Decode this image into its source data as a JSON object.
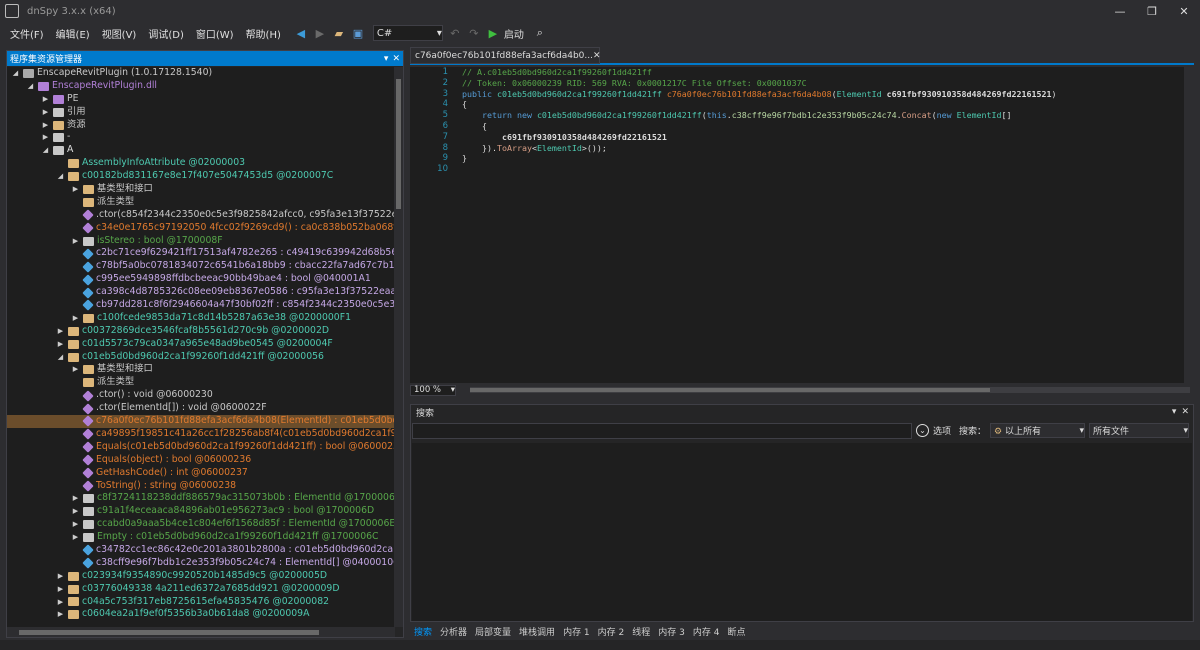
{
  "window": {
    "title": "dnSpy 3.x.x (x64)"
  },
  "menu": [
    "文件(F)",
    "编辑(E)",
    "视图(V)",
    "调试(D)",
    "窗口(W)",
    "帮助(H)"
  ],
  "toolbar": {
    "language": "C#",
    "run_label": "启动"
  },
  "assembly_panel": {
    "title": "程序集资源管理器"
  },
  "tree": [
    {
      "indent": 0,
      "exp": "◢",
      "icon": "assembly",
      "color": "#aaaaaa",
      "text": "EnscapeRevitPlugin (1.0.17128.1540)",
      "tc": "#c8c8c8"
    },
    {
      "indent": 1,
      "exp": "◢",
      "icon": "module",
      "color": "#b180d7",
      "text": "EnscapeRevitPlugin.dll",
      "tc": "#b180d7"
    },
    {
      "indent": 2,
      "exp": "▶",
      "icon": "pe",
      "color": "#b180d7",
      "text": "PE",
      "tc": "#c8c8c8"
    },
    {
      "indent": 2,
      "exp": "▶",
      "icon": "ref",
      "color": "#c8c8c8",
      "text": "引用",
      "tc": "#c8c8c8"
    },
    {
      "indent": 2,
      "exp": "▶",
      "icon": "folder",
      "color": "#dcb67a",
      "text": "资源",
      "tc": "#c8c8c8"
    },
    {
      "indent": 2,
      "exp": "▶",
      "icon": "namespace",
      "color": "#c8c8c8",
      "text": "-",
      "tc": "#c8c8c8"
    },
    {
      "indent": 2,
      "exp": "◢",
      "icon": "namespace",
      "color": "#c8c8c8",
      "text": "A",
      "tc": "#e0e0e0"
    },
    {
      "indent": 3,
      "exp": "",
      "icon": "class",
      "color": "#dcb67a",
      "text": "AssemblyInfoAttribute @02000003",
      "tc": "#4ec9b0"
    },
    {
      "indent": 3,
      "exp": "◢",
      "icon": "class",
      "color": "#dcb67a",
      "text": "c00182bd831167e8e17f407e5047453d5 @0200007C",
      "tc": "#4ec9b0"
    },
    {
      "indent": 4,
      "exp": "▶",
      "icon": "folder",
      "color": "#dcb67a",
      "text": "基类型和接口",
      "tc": "#c8c8c8"
    },
    {
      "indent": 4,
      "exp": "",
      "icon": "folder",
      "color": "#dcb67a",
      "text": "派生类型",
      "tc": "#c8c8c8"
    },
    {
      "indent": 4,
      "exp": "",
      "icon": "method",
      "color": "#b180d7",
      "text": ".ctor(c854f2344c2350e0c5e3f9825842afcc0, c95fa3e13f37522eaa",
      "tc": "#c8c8c8"
    },
    {
      "indent": 4,
      "exp": "",
      "icon": "method",
      "color": "#b180d7",
      "text": "c34e0e1765c97192050 4fcc02f9269cd9() : ca0c838b052ba068fb7",
      "tc": "#e07a2e"
    },
    {
      "indent": 4,
      "exp": "▶",
      "icon": "prop",
      "color": "#c8c8c8",
      "text": "isStereo : bool @1700008F",
      "tc": "#57a64a"
    },
    {
      "indent": 4,
      "exp": "",
      "icon": "field",
      "color": "#4aa3df",
      "text": "c2bc71ce9f629421ff17513af4782e265 : c49419c639942d68b56c0",
      "tc": "#c5a8e6"
    },
    {
      "indent": 4,
      "exp": "",
      "icon": "field",
      "color": "#4aa3df",
      "text": "c78bf5a0bc0781834072c6541b6a18bb9 : cbacc22fa7ad67c7b1a6",
      "tc": "#c5a8e6"
    },
    {
      "indent": 4,
      "exp": "",
      "icon": "field",
      "color": "#4aa3df",
      "text": "c995ee5949898ffdbcbeeac90bb49bae4 : bool @040001A1",
      "tc": "#c5a8e6"
    },
    {
      "indent": 4,
      "exp": "",
      "icon": "field",
      "color": "#4aa3df",
      "text": "ca398c4d8785326c08ee09eb8367e0586 : c95fa3e13f37522eaa46",
      "tc": "#c5a8e6"
    },
    {
      "indent": 4,
      "exp": "",
      "icon": "field",
      "color": "#4aa3df",
      "text": "cb97dd281c8f6f2946604a47f30bf02ff : c854f2344c2350e0c5e3f9",
      "tc": "#c5a8e6"
    },
    {
      "indent": 4,
      "exp": "▶",
      "icon": "class",
      "color": "#dcb67a",
      "text": "c100fcede9853da71c8d14b5287a63e38 @0200000F1",
      "tc": "#4ec9b0"
    },
    {
      "indent": 3,
      "exp": "▶",
      "icon": "class",
      "color": "#dcb67a",
      "text": "c00372869dce3546fcaf8b5561d270c9b @0200002D",
      "tc": "#4ec9b0"
    },
    {
      "indent": 3,
      "exp": "▶",
      "icon": "class",
      "color": "#dcb67a",
      "text": "c01d5573c79ca0347a965e48ad9be0545 @0200004F",
      "tc": "#4ec9b0"
    },
    {
      "indent": 3,
      "exp": "◢",
      "icon": "class",
      "color": "#dcb67a",
      "text": "c01eb5d0bd960d2ca1f99260f1dd421ff @02000056",
      "tc": "#4ec9b0"
    },
    {
      "indent": 4,
      "exp": "▶",
      "icon": "folder",
      "color": "#dcb67a",
      "text": "基类型和接口",
      "tc": "#c8c8c8"
    },
    {
      "indent": 4,
      "exp": "",
      "icon": "folder",
      "color": "#dcb67a",
      "text": "派生类型",
      "tc": "#c8c8c8"
    },
    {
      "indent": 4,
      "exp": "",
      "icon": "method",
      "color": "#b180d7",
      "text": ".ctor() : void @06000230",
      "tc": "#c8c8c8"
    },
    {
      "indent": 4,
      "exp": "",
      "icon": "method",
      "color": "#b180d7",
      "text": ".ctor(ElementId[]) : void @0600022F",
      "tc": "#c8c8c8"
    },
    {
      "indent": 4,
      "exp": "",
      "icon": "method",
      "color": "#b180d7",
      "text": "c76a0f0ec76b101fd88efa3acf6da4b08(ElementId) : c01eb5d0bd9",
      "tc": "#e07a2e",
      "sel": true
    },
    {
      "indent": 4,
      "exp": "",
      "icon": "method",
      "color": "#b180d7",
      "text": "ca49895f19851c41a26cc1f28256ab8f4(c01eb5d0bd960d2ca1f99",
      "tc": "#e07a2e"
    },
    {
      "indent": 4,
      "exp": "",
      "icon": "method",
      "color": "#b180d7",
      "text": "Equals(c01eb5d0bd960d2ca1f99260f1dd421ff) : bool @06000235",
      "tc": "#e07a2e"
    },
    {
      "indent": 4,
      "exp": "",
      "icon": "method",
      "color": "#b180d7",
      "text": "Equals(object) : bool @06000236",
      "tc": "#e07a2e"
    },
    {
      "indent": 4,
      "exp": "",
      "icon": "method",
      "color": "#b180d7",
      "text": "GetHashCode() : int @06000237",
      "tc": "#e07a2e"
    },
    {
      "indent": 4,
      "exp": "",
      "icon": "method",
      "color": "#b180d7",
      "text": "ToString() : string @06000238",
      "tc": "#e07a2e"
    },
    {
      "indent": 4,
      "exp": "▶",
      "icon": "prop",
      "color": "#c8c8c8",
      "text": "c8f3724118238ddf886579ac315073b0b : ElementId @1700006F",
      "tc": "#57a64a"
    },
    {
      "indent": 4,
      "exp": "▶",
      "icon": "prop",
      "color": "#c8c8c8",
      "text": "c91a1f4eceaaca84896ab01e956273ac9 : bool @1700006D",
      "tc": "#57a64a"
    },
    {
      "indent": 4,
      "exp": "▶",
      "icon": "prop",
      "color": "#c8c8c8",
      "text": "ccabd0a9aaa5b4ce1c804ef6f1568d85f : ElementId @1700006E",
      "tc": "#57a64a"
    },
    {
      "indent": 4,
      "exp": "▶",
      "icon": "prop",
      "color": "#c8c8c8",
      "text": "Empty : c01eb5d0bd960d2ca1f99260f1dd421ff @1700006C",
      "tc": "#57a64a"
    },
    {
      "indent": 4,
      "exp": "",
      "icon": "field",
      "color": "#4aa3df",
      "text": "c34782cc1ec86c42e0c201a3801b2800a : c01eb5d0bd960d2ca1f",
      "tc": "#c5a8e6"
    },
    {
      "indent": 4,
      "exp": "",
      "icon": "field",
      "color": "#4aa3df",
      "text": "c38cff9e96f7bdb1c2e353f9b05c24c74 : ElementId[] @04000106",
      "tc": "#c5a8e6"
    },
    {
      "indent": 3,
      "exp": "▶",
      "icon": "class",
      "color": "#dcb67a",
      "text": "c023934f9354890c9920520b1485d9c5 @0200005D",
      "tc": "#4ec9b0"
    },
    {
      "indent": 3,
      "exp": "▶",
      "icon": "class",
      "color": "#dcb67a",
      "text": "c03776049338 4a211ed6372a7685dd921 @0200009D",
      "tc": "#4ec9b0"
    },
    {
      "indent": 3,
      "exp": "▶",
      "icon": "class",
      "color": "#dcb67a",
      "text": "c04a5c753f317eb8725615efa45835476 @02000082",
      "tc": "#4ec9b0"
    },
    {
      "indent": 3,
      "exp": "▶",
      "icon": "class",
      "color": "#dcb67a",
      "text": "c0604ea2a1f9ef0f5356b3a0b61da8 @0200009A",
      "tc": "#4ec9b0"
    }
  ],
  "code_tab": {
    "label": "c76a0f0ec76b101fd88efa3acf6da4b0..."
  },
  "code_lines": [
    {
      "n": "1",
      "parts": [
        [
          "cm",
          "// A.c01eb5d0bd960d2ca1f99260f1dd421ff"
        ]
      ]
    },
    {
      "n": "2",
      "parts": [
        [
          "cm",
          "// Token: 0x06000239 RID: 569 RVA: 0x0001217C File Offset: 0x0001037C"
        ]
      ]
    },
    {
      "n": "3",
      "parts": [
        [
          "kw",
          "public "
        ],
        [
          "ty",
          "c01eb5d0bd960d2ca1f99260f1dd421ff "
        ],
        [
          "org",
          "c76a0f0ec76b101fd88efa3acf6da4b08"
        ],
        [
          "t",
          "("
        ],
        [
          "ty",
          "ElementId "
        ],
        [
          "id",
          "c691fbf930910358d484269fd22161521"
        ],
        [
          "t",
          ")"
        ]
      ]
    },
    {
      "n": "4",
      "parts": [
        [
          "t",
          "{"
        ]
      ]
    },
    {
      "n": "5",
      "parts": [
        [
          "t",
          "    "
        ],
        [
          "kw",
          "return new "
        ],
        [
          "ty",
          "c01eb5d0bd960d2ca1f99260f1dd421ff"
        ],
        [
          "t",
          "("
        ],
        [
          "kw",
          "this"
        ],
        [
          "t",
          "."
        ],
        [
          "pur",
          "c38cff9e96f7bdb1c2e353f9b05c24c74"
        ],
        [
          "t",
          "."
        ],
        [
          "mth",
          "Concat"
        ],
        [
          "t",
          "("
        ],
        [
          "kw",
          "new "
        ],
        [
          "ty",
          "ElementId"
        ],
        [
          "t",
          "[]"
        ]
      ]
    },
    {
      "n": "6",
      "parts": [
        [
          "t",
          "    {"
        ]
      ]
    },
    {
      "n": "7",
      "parts": [
        [
          "t",
          "        "
        ],
        [
          "id",
          "c691fbf930910358d484269fd22161521"
        ]
      ]
    },
    {
      "n": "8",
      "parts": [
        [
          "t",
          "    })."
        ],
        [
          "mth",
          "ToArray"
        ],
        [
          "t",
          "<"
        ],
        [
          "ty",
          "ElementId"
        ],
        [
          "t",
          ">());"
        ]
      ]
    },
    {
      "n": "9",
      "parts": [
        [
          "t",
          "}"
        ]
      ]
    },
    {
      "n": "10",
      "parts": [
        [
          "t",
          ""
        ]
      ]
    }
  ],
  "zoom": "100 %",
  "search_panel": {
    "title": "搜索",
    "options_label": "选项",
    "search_label": "搜索：",
    "scope": "以上所有",
    "filter": "所有文件"
  },
  "bottom_tabs": [
    "搜索",
    "分析器",
    "局部变量",
    "堆栈调用",
    "内存 1",
    "内存 2",
    "线程",
    "内存 3",
    "内存 4",
    "断点"
  ]
}
